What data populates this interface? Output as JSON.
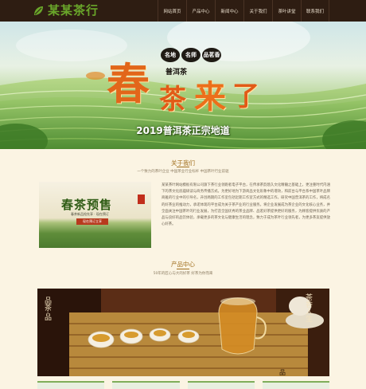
{
  "header": {
    "logo_text": "某某茶行",
    "nav": [
      "网站首页",
      "产品中心",
      "新闻中心",
      "关于我们",
      "茶叶讲堂",
      "联系我们"
    ]
  },
  "banner": {
    "badges": [
      "名地",
      "名师",
      "品茗香"
    ],
    "sub_brand": "普洱茶",
    "slogan_chars": [
      "春",
      "茶",
      "来",
      "了"
    ],
    "caption": "2019普洱茶正宗地道"
  },
  "about": {
    "title": "关于我们",
    "subtitle": "一个致力的茶叶企业 中国茶业行业标杆 中国茶叶行业前驱",
    "image": {
      "title": "春茶预售",
      "sub": "春茶新品抢先享 · 现在预订",
      "button": "现在预订立享"
    },
    "text": "某某茶叶网站模板有限公司旗下茶行业领跑者电子平台，在传承茶韵悠久文化精髓之基础上，更注重时代内涵下的茶文化底蕴研读与商务传播方式。为更好地为下游商品文化形象中的增效，和前台与平台系中国茶叶品牌商雅的行业中的引导名，开创两期的工作室包括近期工作室方式的精选工作，研究中国普洱茶的工作，将成名的好茶业的推动力，承诺体现的平台成为关于茶产业的行业服务。将企业发展成为茶企业的文化核心业务，并全面关注中国茶叶的行业发展，为打造全国优秀的茶业品牌、品茗好茶提供更好的服务，为顾客提供优质的产品与良好的品饮体验，承载更多的茶文化与健康生活的理念，致力于成为茶叶行业领先者，为更多茶友提供放心好茶。"
  },
  "products": {
    "title": "产品中心",
    "subtitle": "50年的匠心与大的好茶 好茶为你而来",
    "image_text_left": "品茶·品",
    "image_text_right": "茶香人生"
  },
  "colors": {
    "header_bg": "#2e1d12",
    "accent": "#a06e1d",
    "page_bg": "#fbf4e3",
    "logo_green": "#6aa62a"
  }
}
